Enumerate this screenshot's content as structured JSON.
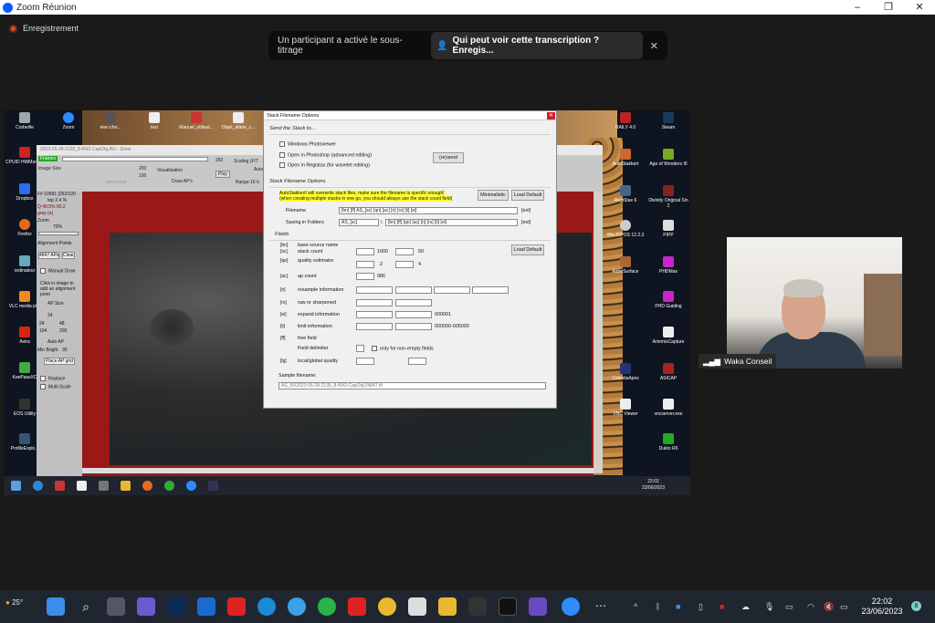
{
  "window": {
    "title": "Zoom Réunion",
    "minimize": "–",
    "maximize": "❐",
    "close": "✕"
  },
  "recording": "Enregistrement",
  "notice": {
    "text": "Un participant a activé le sous-titrage",
    "question": "Qui peut voir cette transcription ? Enregis...",
    "close": "✕"
  },
  "shared_desktop": {
    "left_icons": [
      "Corbeille",
      "CPUID HWMonitor",
      "Dropbox",
      "Firefox",
      "ordinateur",
      "VLC media pl...",
      "Avira",
      "KeePassXC",
      "EOS Utility",
      "ProfileExplo..."
    ],
    "top_icons": [
      "Zoom",
      "elec-che...",
      "test",
      "Manuel_utilisat...",
      "Objet_afaire_c..."
    ],
    "right_icons_col1": [
      "RAILY 4.0",
      "AutoStakkert",
      "RegiStax 6",
      "WinJUPOS 12.2.3",
      "AstroSurface",
      "CelestiaApex",
      "VNC Viewer"
    ],
    "right_icons_col2": [
      "Steam",
      "Age of Wonders III",
      "Divinity Original Sin 2",
      "PIPP",
      "PHDMax",
      "PHD Guiding",
      "ArtemisCapture",
      "ASICAP",
      "vncserver.exe",
      "Dukto R6"
    ],
    "ass_title": "2023-05-28-2135_8-f642-CapObj.AVI - Done",
    "left_panel": {
      "frames": "Frames",
      "image_size": "Image Size",
      "visualisation": "Visualisation",
      "draw_aps": "Draw AP's",
      "scaling": "Scaling (F/T",
      "auto": "Auto",
      "range": "Range 16 b",
      "play": "Play",
      "remember": "remember",
      "stats": "F# 10991 [292/120",
      "top": "top 2.4 %",
      "q": "Q 49.5% 60.2",
      "gray": "gray (a)",
      "zoom": "Zoom",
      "zoom_pct": "70%",
      "alignment_points": "Alignment Points",
      "aps": "4847 APs",
      "clear": "Clear",
      "manual_draw": "Manual Draw",
      "click_text": "Click in image to add an alignment point",
      "ap_size": "AP Size",
      "sizes": [
        "24",
        "24",
        "48",
        "104",
        "200"
      ],
      "auto_ap": "Auto AP",
      "min_bright": "Min Bright",
      "min_bright_val": "30",
      "place_ap": "Place AP grid",
      "replace": "Replace",
      "multiscale": "Multi-Scale",
      "num1": "200",
      "num2": "100",
      "num3": "292"
    },
    "clock_time": "22:02",
    "clock_date": "23/06/2023"
  },
  "dialog": {
    "title": "Stack Filename Options",
    "close": "✕",
    "send_section": "Send the Stack to...",
    "send_options": [
      "Windows Photoviewer",
      "Open in Photoshop (advanced editing)",
      "Open in Registax (for wavelet editing)"
    ],
    "resend": "(re)send",
    "options_section": "Stack Filename Options",
    "warning_line1": "AutoStakkert! will overwrite stack files, make sure the filename is specific enough!",
    "warning_line2": "(when creating multiple stacks in one go, you should always use the stack count field)",
    "minimalistic": "Minimalistic",
    "load_default": "Load Default",
    "filename_label": "Filename",
    "filename_value": "[bn] [ff] AS_[sc] [qn] [ac] [n] [rs] [li] [ei]",
    "filename_ext": "[ext]",
    "folders_label": "Saving in Folders",
    "folders_value": "AS_[sc]",
    "folders_value2": "[bn] [ff] [qn] [ac] [n] [rs] [li] [ei]",
    "folders_ext": "[ext]",
    "fields_section": "Fields",
    "load_default2": "Load Default",
    "fields": [
      {
        "code": "[bn]",
        "label": "base source name"
      },
      {
        "code": "[sc]",
        "label": "stack count",
        "v1": "1000",
        "v2": "50"
      },
      {
        "code": "[qe]",
        "label": "quality estimator",
        "v1": "2",
        "v2": "4"
      },
      {
        "code": "[ac]",
        "label": "ap count",
        "v1": "986"
      },
      {
        "code": "[n]",
        "label": "resample information"
      },
      {
        "code": "[rs]",
        "label": "raw or sharpened"
      },
      {
        "code": "[ei]",
        "label": "expand information",
        "v2": "000001"
      },
      {
        "code": "[li]",
        "label": "limit information",
        "v2": "000000-005000"
      },
      {
        "code": "[ff]",
        "label": "free field"
      },
      {
        "code": "",
        "label": "Field delimiter",
        "extra": "only for non-empty fields"
      },
      {
        "code": "[lg]",
        "label": "local/global quality"
      }
    ],
    "sample_label": "Sample filename:",
    "sample_value": "AS_50\\2023-05-28-2135_8-f642-CapObj\\24847.tif"
  },
  "video": {
    "name": "Waka Conseil"
  },
  "taskbar": {
    "weather": "25°",
    "time": "22:02",
    "date": "23/06/2023",
    "badge": "8"
  }
}
